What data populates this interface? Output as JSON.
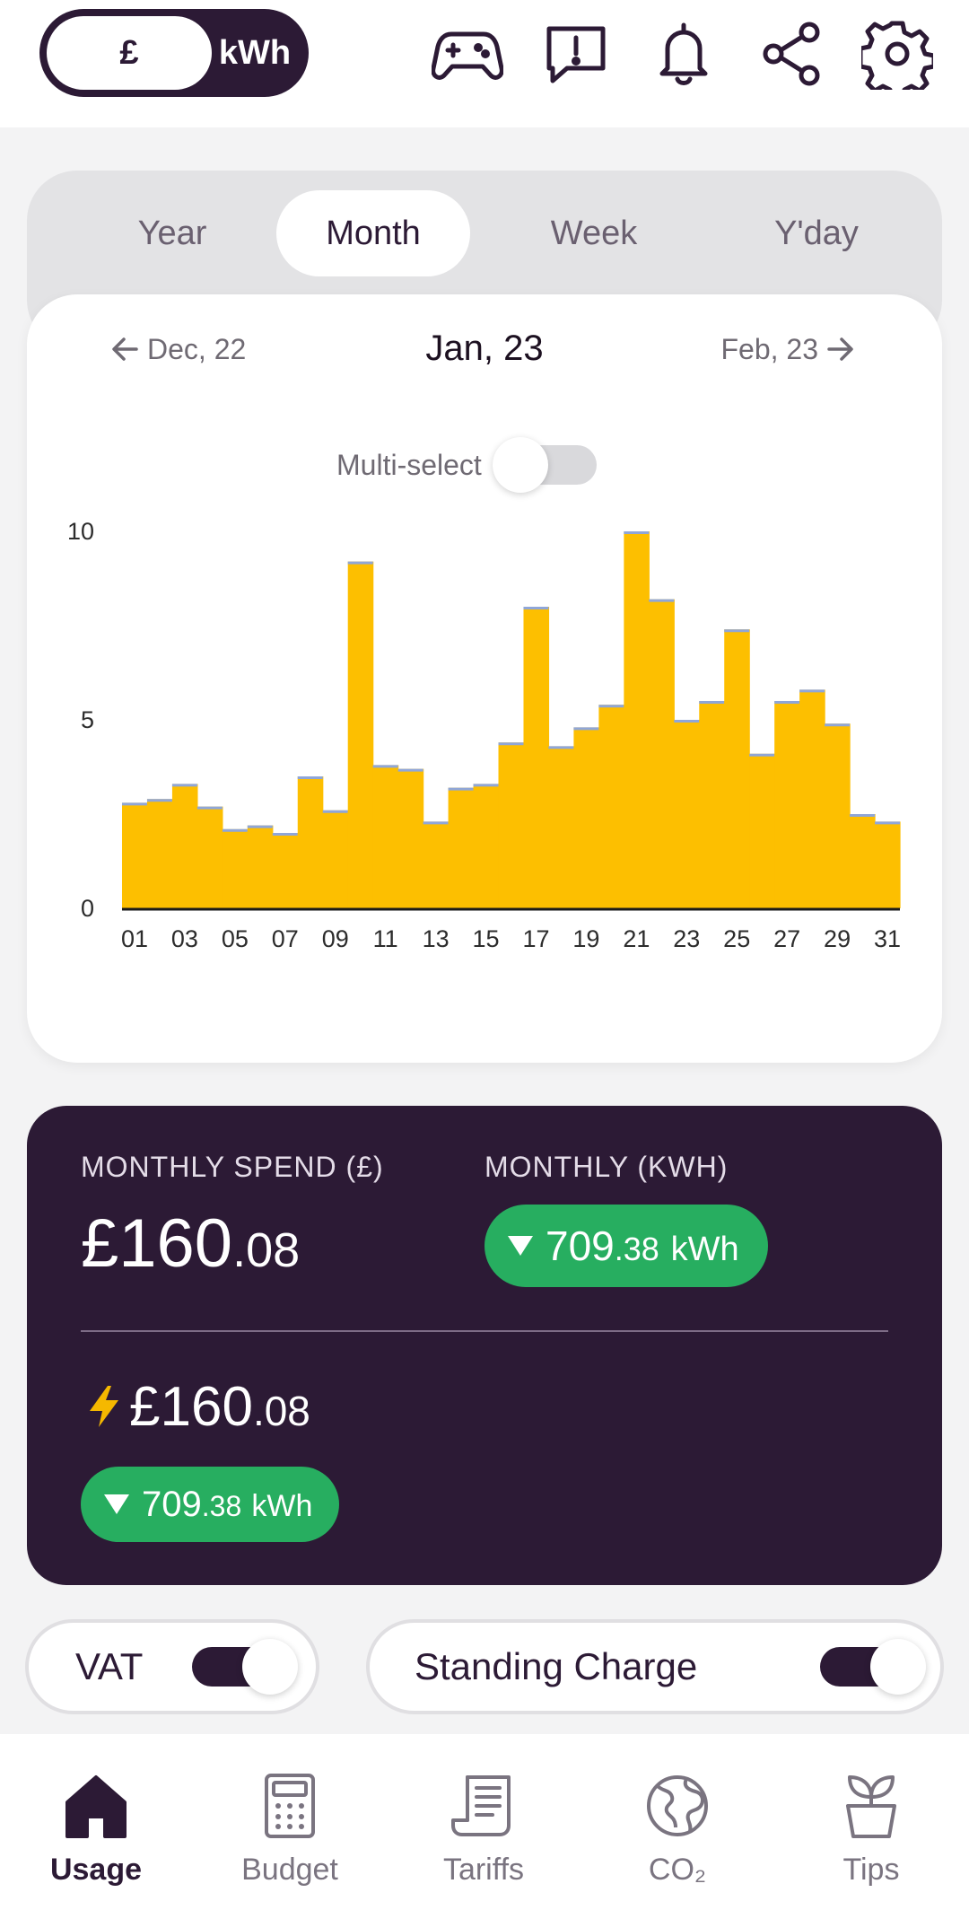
{
  "header": {
    "unit_toggle": {
      "pound_label": "£",
      "kwh_label": "kWh",
      "selected": "£"
    },
    "icons": [
      "gamepad-icon",
      "feedback-icon",
      "bell-icon",
      "share-icon",
      "gear-icon"
    ]
  },
  "period_tabs": [
    {
      "label": "Year"
    },
    {
      "label": "Month",
      "active": true
    },
    {
      "label": "Week"
    },
    {
      "label": "Y'day"
    }
  ],
  "date_nav": {
    "prev": "Dec, 22",
    "current": "Jan, 23",
    "next": "Feb, 23"
  },
  "multi_select": {
    "label": "Multi-select",
    "on": false
  },
  "chart_data": {
    "type": "bar",
    "title": "",
    "xlabel": "",
    "ylabel": "",
    "categories": [
      "01",
      "02",
      "03",
      "04",
      "05",
      "06",
      "07",
      "08",
      "09",
      "10",
      "11",
      "12",
      "13",
      "14",
      "15",
      "16",
      "17",
      "18",
      "19",
      "20",
      "21",
      "22",
      "23",
      "24",
      "25",
      "26",
      "27",
      "28",
      "29",
      "30",
      "31"
    ],
    "x_tick_labels": [
      "01",
      "03",
      "05",
      "07",
      "09",
      "11",
      "13",
      "15",
      "17",
      "19",
      "21",
      "23",
      "25",
      "27",
      "29",
      "31"
    ],
    "values": [
      2.8,
      2.9,
      3.3,
      2.7,
      2.1,
      2.2,
      2.0,
      3.5,
      2.6,
      9.2,
      3.8,
      3.7,
      2.3,
      3.2,
      3.3,
      4.4,
      8.0,
      4.3,
      4.8,
      5.4,
      10.0,
      8.2,
      5.0,
      5.5,
      7.4,
      4.1,
      5.5,
      5.8,
      4.9,
      2.5,
      2.3
    ],
    "y_ticks": [
      0,
      5,
      10
    ],
    "ylim": [
      0,
      10
    ],
    "bar_color": "#fdbf00",
    "top_edge_color": "#8fa6d8",
    "grid": false,
    "legend": "none"
  },
  "summary": {
    "monthly_spend_label": "MONTHLY SPEND (£)",
    "monthly_kwh_label": "MONTHLY (KWH)",
    "spend_main": "£160",
    "spend_decimal": ".08",
    "kwh_main": "709",
    "kwh_decimal": ".38",
    "kwh_unit": "kWh",
    "electric_spend_main": "£160",
    "electric_spend_decimal": ".08",
    "electric_kwh_main": "709",
    "electric_kwh_decimal": ".38",
    "electric_kwh_unit": "kWh",
    "pill_color": "#27ae60"
  },
  "options": {
    "vat_label": "VAT",
    "vat_on": true,
    "standing_charge_label": "Standing Charge",
    "standing_charge_on": true
  },
  "bottom_nav": [
    {
      "label": "Usage",
      "icon": "home-icon",
      "active": true
    },
    {
      "label": "Budget",
      "icon": "calculator-icon"
    },
    {
      "label": "Tariffs",
      "icon": "receipt-icon"
    },
    {
      "label": "CO₂",
      "icon": "globe-icon"
    },
    {
      "label": "Tips",
      "icon": "plant-icon"
    }
  ],
  "colors": {
    "brand_dark": "#2c1a35",
    "accent_yellow": "#fdbf00",
    "success_green": "#27ae60"
  }
}
